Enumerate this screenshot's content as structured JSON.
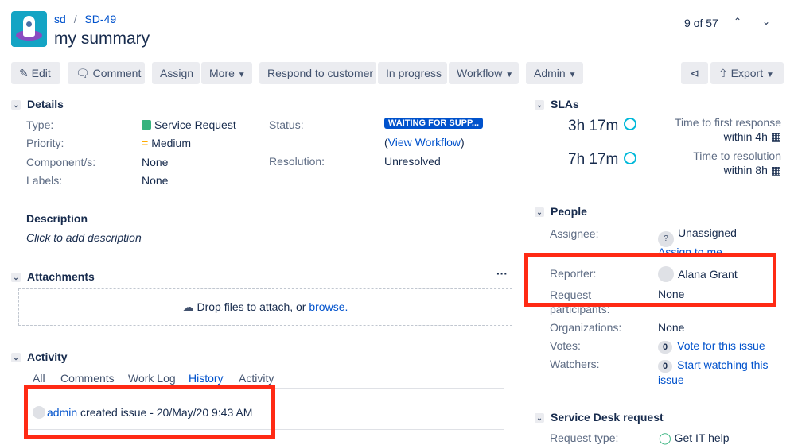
{
  "breadcrumb": {
    "project": "sd",
    "issue": "SD-49"
  },
  "title": "my summary",
  "pager": {
    "text": "9 of 57"
  },
  "toolbar": {
    "edit": "Edit",
    "comment": "Comment",
    "assign": "Assign",
    "more": "More",
    "respond": "Respond to customer",
    "in_progress": "In progress",
    "workflow": "Workflow",
    "admin": "Admin",
    "export": "Export"
  },
  "details": {
    "heading": "Details",
    "type_label": "Type:",
    "type": "Service Request",
    "priority_label": "Priority:",
    "priority": "Medium",
    "components_label": "Component/s:",
    "components": "None",
    "labels_label": "Labels:",
    "labels": "None",
    "status_label": "Status:",
    "status": "WAITING FOR SUPP...",
    "view_workflow": "View Workflow",
    "resolution_label": "Resolution:",
    "resolution": "Unresolved"
  },
  "description": {
    "heading": "Description",
    "placeholder": "Click to add description"
  },
  "attachments": {
    "heading": "Attachments",
    "drop": "Drop files to attach, or ",
    "browse": "browse."
  },
  "activity": {
    "heading": "Activity",
    "tabs": [
      "All",
      "Comments",
      "Work Log",
      "History",
      "Activity"
    ],
    "entry_user": "admin",
    "entry_text": " created issue - 20/May/20 9:43 AM"
  },
  "slas": {
    "heading": "SLAs",
    "items": [
      {
        "time": "3h 17m",
        "name": "Time to first response",
        "goal": "within 4h"
      },
      {
        "time": "7h 17m",
        "name": "Time to resolution",
        "goal": "within 8h"
      }
    ]
  },
  "people": {
    "heading": "People",
    "assignee_label": "Assignee:",
    "assignee": "Unassigned",
    "assign_to_me": "Assign to me",
    "reporter_label": "Reporter:",
    "reporter": "Alana Grant",
    "participants_label": "Request participants:",
    "participants": "None",
    "orgs_label": "Organizations:",
    "orgs": "None",
    "votes_label": "Votes:",
    "votes": "0",
    "vote_link": "Vote for this issue",
    "watchers_label": "Watchers:",
    "watchers": "0",
    "watch_link": "Start watching this issue"
  },
  "sd_request": {
    "heading": "Service Desk request",
    "type_label": "Request type:",
    "type": "Get IT help"
  }
}
